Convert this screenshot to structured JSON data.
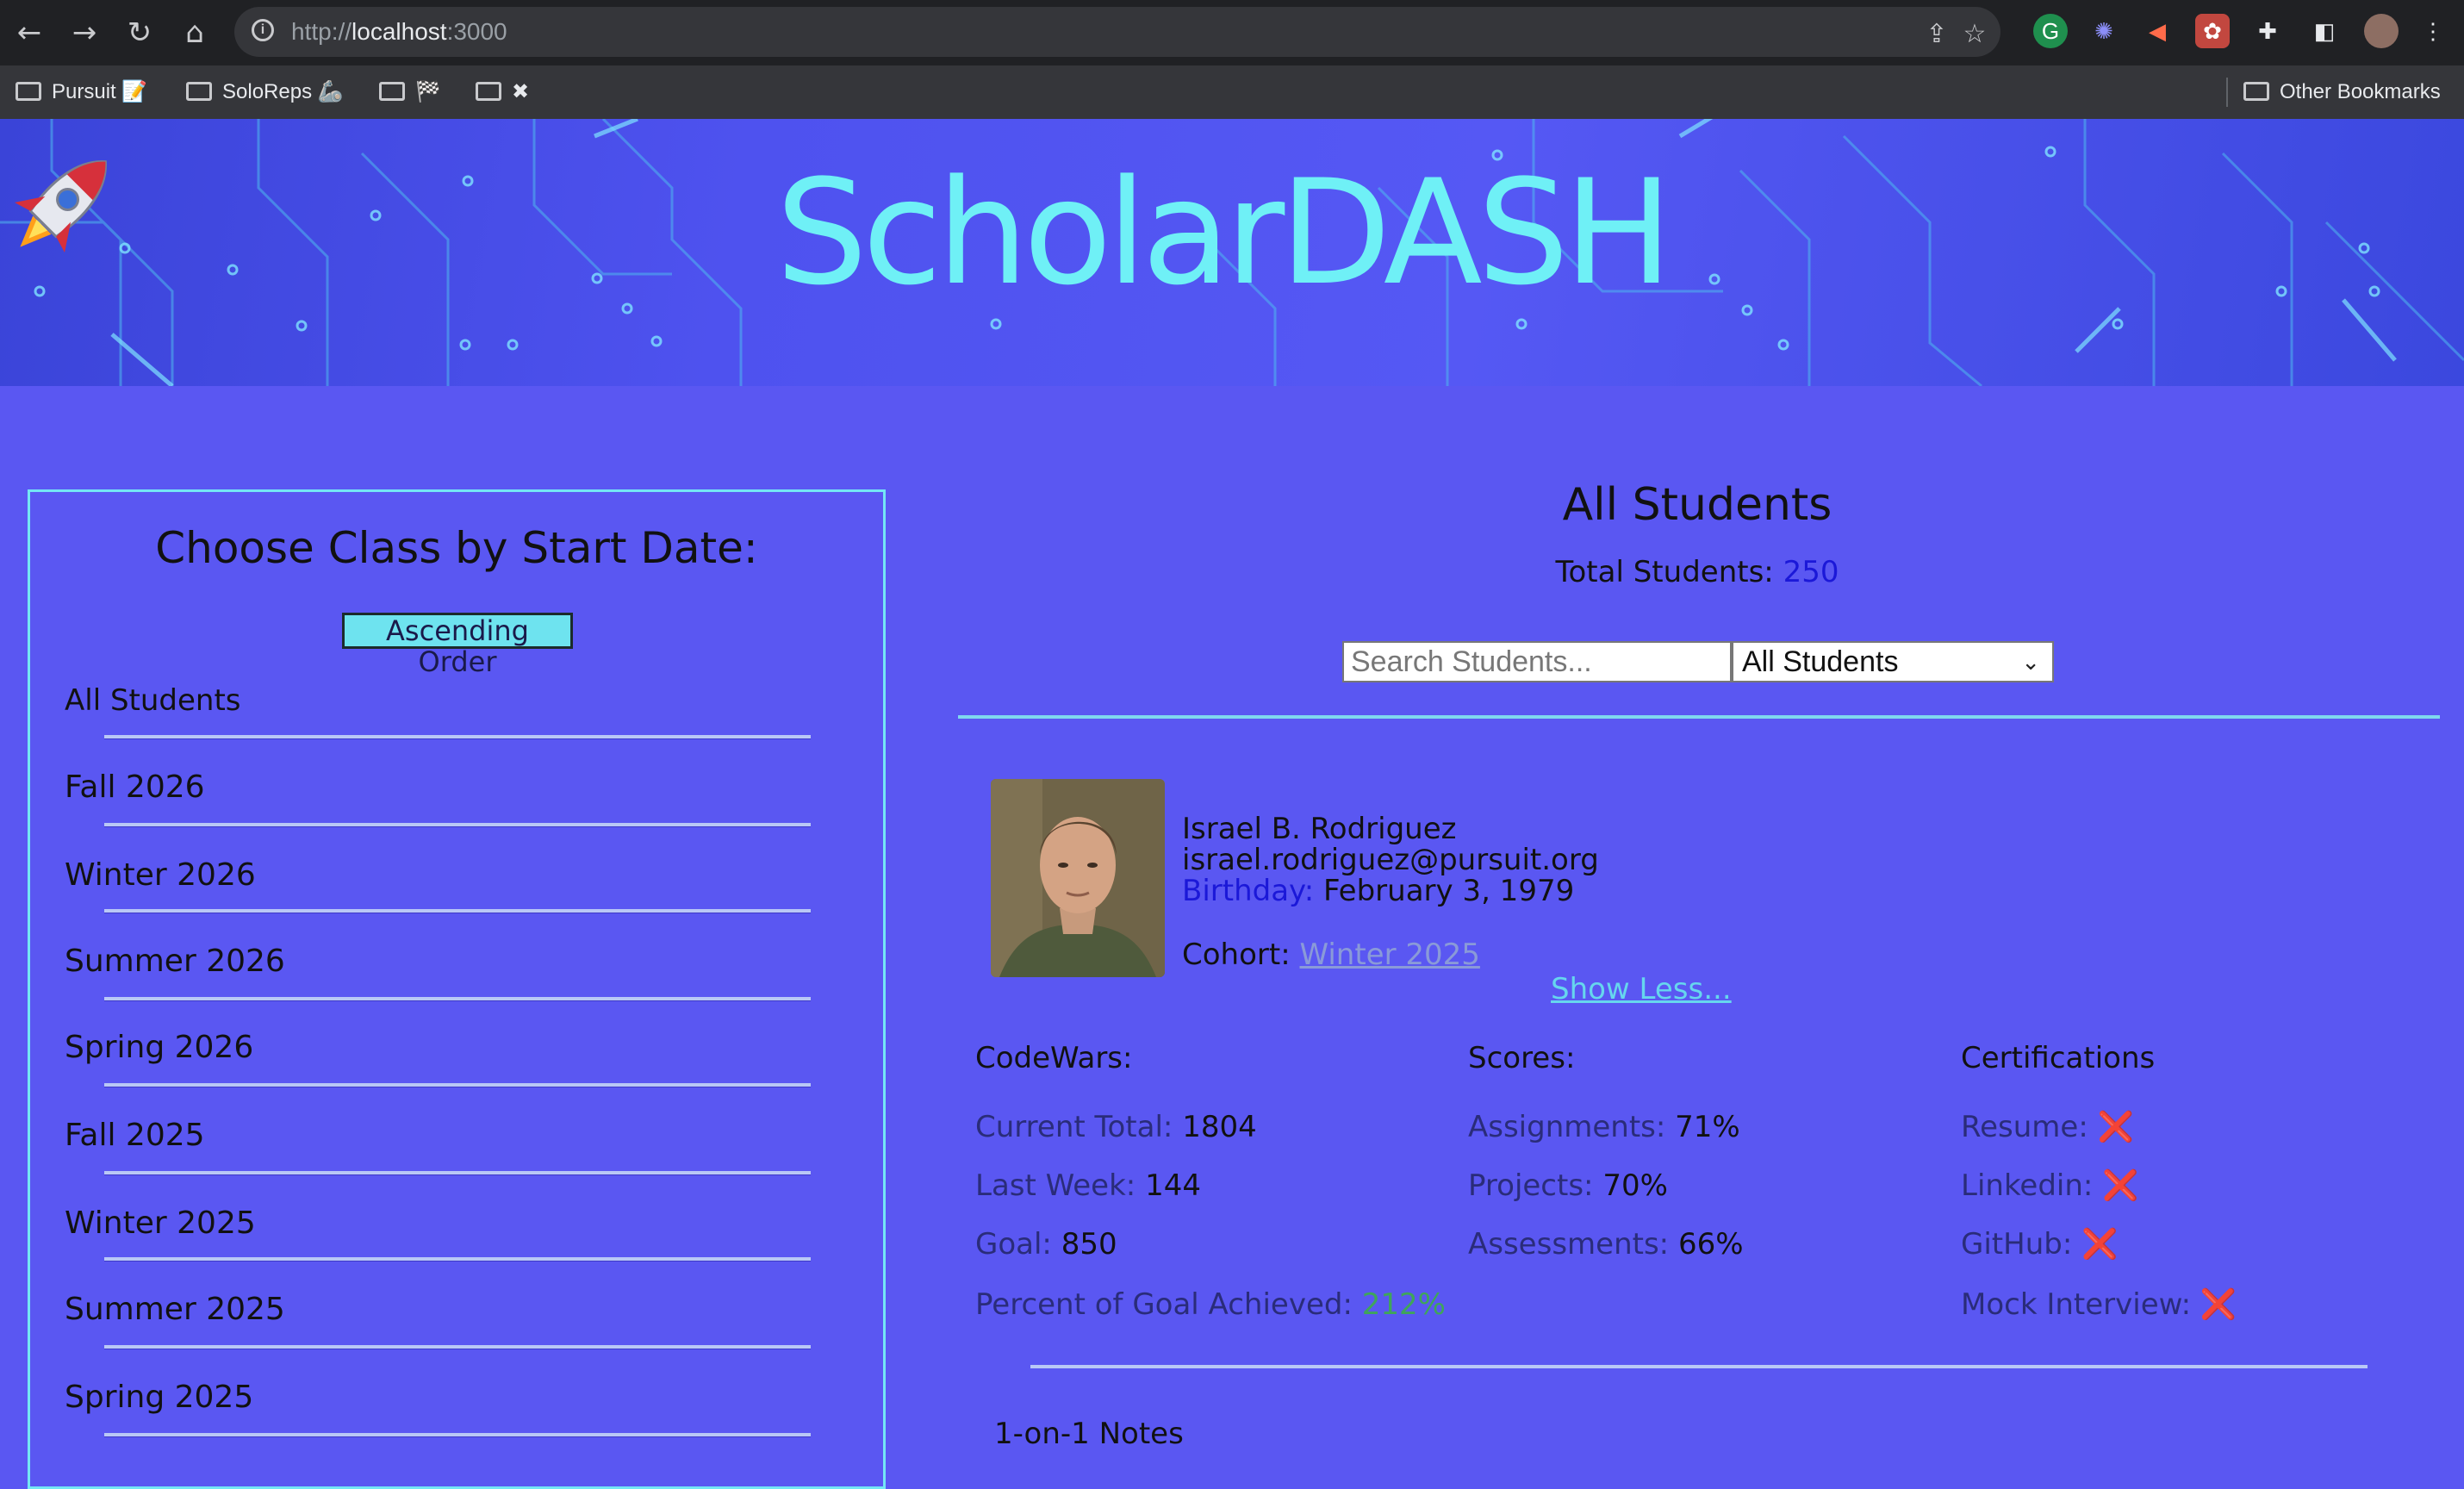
{
  "browser": {
    "url_scheme": "http://",
    "url_host": "localhost",
    "url_port": ":3000",
    "bookmarks": [
      "Pursuit 📝",
      "SoloReps 🦾",
      "🏁",
      "✖"
    ],
    "other_bookmarks": "Other Bookmarks"
  },
  "site": {
    "title": "ScholarDASH",
    "accent": "#6ff0f6"
  },
  "sidebar": {
    "title": "Choose Class by Start Date:",
    "sort_label": "Ascending Order",
    "classes": [
      "All Students",
      "Fall 2026",
      "Winter 2026",
      "Summer 2026",
      "Spring 2026",
      "Fall 2025",
      "Winter 2025",
      "Summer 2025",
      "Spring 2025"
    ]
  },
  "main": {
    "title": "All Students",
    "total_label": "Total Students:",
    "total_value": "250",
    "search_placeholder": "Search Students...",
    "filter_selected": "All Students"
  },
  "student": {
    "name": "Israel B. Rodriguez",
    "email": "israel.rodriguez@pursuit.org",
    "birthday_label": "Birthday:",
    "birthday": "February 3, 1979",
    "cohort_label": "Cohort:",
    "cohort": "Winter 2025",
    "toggle_label": "Show Less...",
    "codewars": {
      "heading": "CodeWars:",
      "current_total_label": "Current Total:",
      "current_total": "1804",
      "last_week_label": "Last Week:",
      "last_week": "144",
      "goal_label": "Goal:",
      "goal": "850",
      "percent_label": "Percent of Goal Achieved:",
      "percent": "212%"
    },
    "scores": {
      "heading": "Scores:",
      "assignments_label": "Assignments:",
      "assignments": "71%",
      "projects_label": "Projects:",
      "projects": "70%",
      "assessments_label": "Assessments:",
      "assessments": "66%"
    },
    "certifications": {
      "heading": "Certifications",
      "resume_label": "Resume:",
      "linkedin_label": "Linkedin:",
      "github_label": "GitHub:",
      "mock_label": "Mock Interview:",
      "mark": "❌"
    },
    "notes_title": "1-on-1 Notes"
  }
}
